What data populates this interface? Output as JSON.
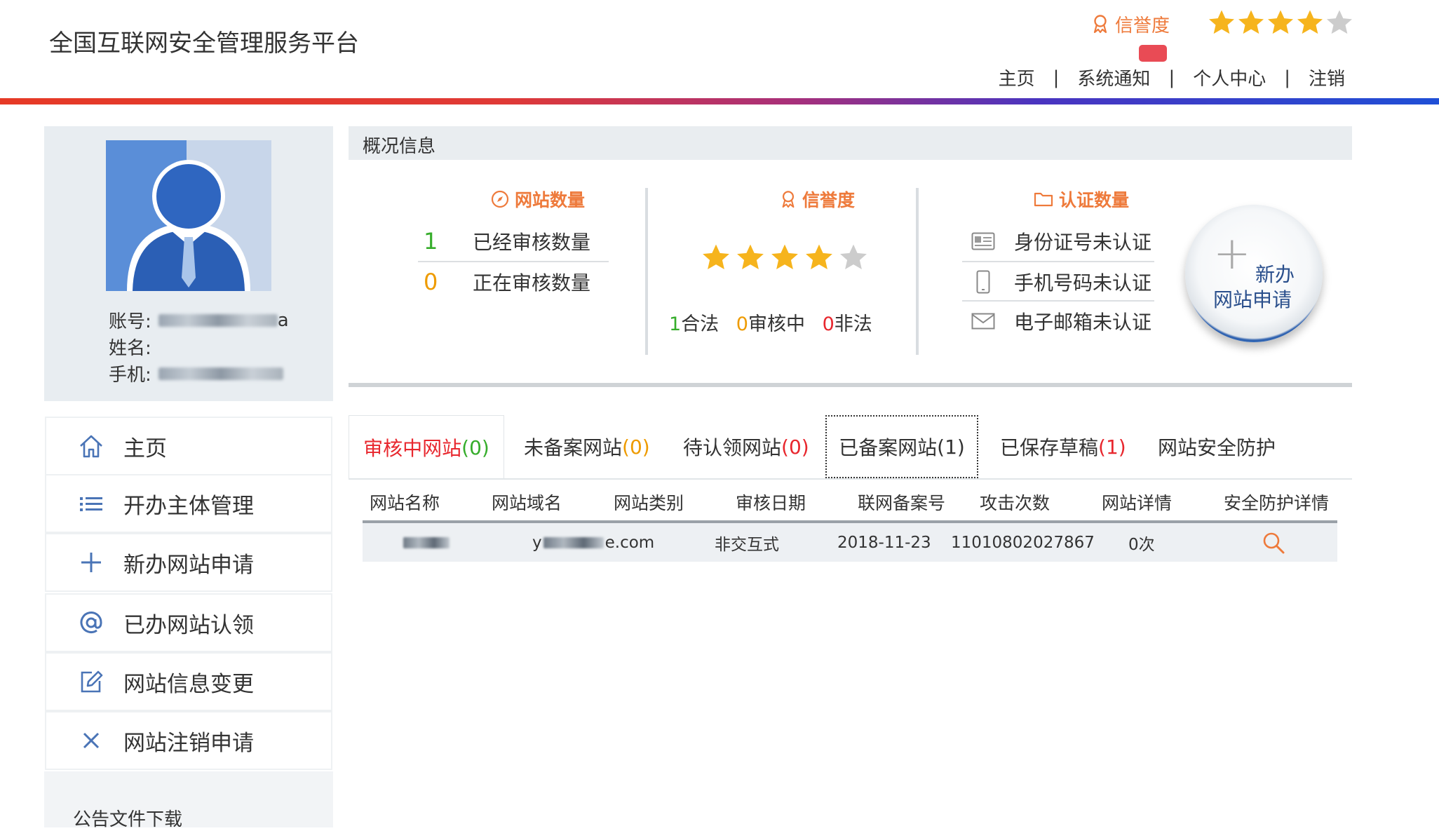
{
  "header": {
    "app_title": "全国互联网安全管理服务平台",
    "credit_label": "信誉度",
    "credit_stars": 4,
    "nav": [
      "主页",
      "系统通知",
      "个人中心",
      "注销"
    ],
    "nav_separator": "|"
  },
  "profile": {
    "account_label": "账号:",
    "account_value_suffix": "a",
    "name_label": "姓名:",
    "phone_label": "手机:"
  },
  "sidebar": {
    "items": [
      {
        "label": "主页",
        "icon": "home-icon"
      },
      {
        "label": "开办主体管理",
        "icon": "list-icon"
      },
      {
        "label": "新办网站申请",
        "icon": "plus-icon"
      },
      {
        "label": "已办网站认领",
        "icon": "at-icon"
      },
      {
        "label": "网站信息变更",
        "icon": "edit-icon"
      },
      {
        "label": "网站注销申请",
        "icon": "close-icon"
      }
    ],
    "announcement": "公告文件下载"
  },
  "overview": {
    "title": "概况信息",
    "website_count": {
      "title": "网站数量",
      "reviewed_count": "1",
      "reviewed_label": "已经审核数量",
      "reviewing_count": "0",
      "reviewing_label": "正在审核数量"
    },
    "credit": {
      "title": "信誉度",
      "stars": 4,
      "legal_count": "1",
      "legal_label": "合法",
      "reviewing_count": "0",
      "reviewing_label": "审核中",
      "illegal_count": "0",
      "illegal_label": "非法"
    },
    "auth": {
      "title": "认证数量",
      "id_card": "身份证号未认证",
      "phone": "手机号码未认证",
      "email": "电子邮箱未认证"
    },
    "new_app_button": {
      "line1": "新办",
      "line2": "网站申请"
    }
  },
  "tabs": [
    {
      "label": "审核中网站",
      "count": "(0)"
    },
    {
      "label": "未备案网站",
      "count": "(0)"
    },
    {
      "label": "待认领网站",
      "count": "(0)"
    },
    {
      "label": "已备案网站",
      "count": "(1)"
    },
    {
      "label": "已保存草稿",
      "count": "(1)"
    },
    {
      "label": "网站安全防护",
      "count": ""
    }
  ],
  "table": {
    "headers": [
      "网站名称",
      "网站域名",
      "网站类别",
      "审核日期",
      "联网备案号",
      "攻击次数",
      "网站详情",
      "安全防护详情"
    ],
    "rows": [
      {
        "domain_prefix": "y",
        "domain_suffix": "e.com",
        "category": "非交互式",
        "date": "2018-11-23",
        "record_no": "11010802027867",
        "attacks": "0次"
      }
    ]
  },
  "colors": {
    "accent_orange": "#ee7a3b",
    "star_gold": "#f6b41d",
    "star_gray": "#cccccc",
    "active_tab_red": "#e8272e",
    "count_green": "#36ad2b",
    "count_orange": "#ee9b00"
  }
}
